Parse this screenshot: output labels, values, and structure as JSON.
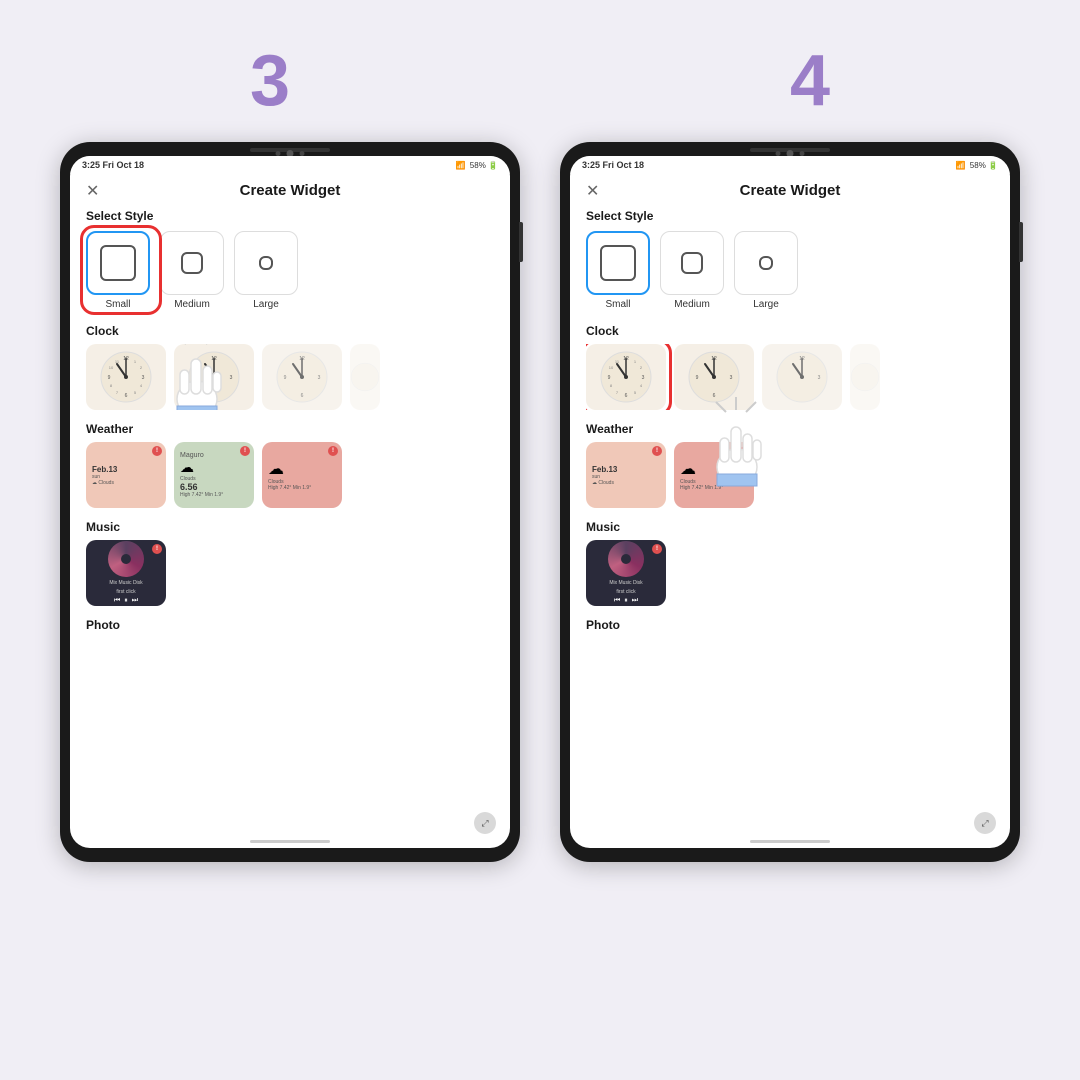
{
  "background_color": "#f0eef5",
  "steps": [
    {
      "number": "3",
      "color": "#9b7ec8"
    },
    {
      "number": "4",
      "color": "#9b7ec8"
    }
  ],
  "tablets": [
    {
      "id": "tablet-3",
      "status_bar": {
        "time": "3:25",
        "date": "Fri Oct 18",
        "signal": "58%",
        "battery": "▪"
      },
      "header": {
        "close": "✕",
        "title": "Create Widget"
      },
      "select_style_label": "Select Style",
      "style_options": [
        {
          "label": "Small",
          "size": "small",
          "selected": true
        },
        {
          "label": "Medium",
          "size": "medium",
          "selected": false
        },
        {
          "label": "Large",
          "size": "large",
          "selected": false
        }
      ],
      "sections": [
        {
          "label": "Clock",
          "widgets": [
            "clock1",
            "clock2",
            "clock3",
            "clock4"
          ]
        },
        {
          "label": "Weather",
          "widgets": [
            "weather1",
            "weather2",
            "weather3"
          ]
        },
        {
          "label": "Music",
          "widgets": [
            "music1"
          ]
        },
        {
          "label": "Photo"
        }
      ],
      "highlight": "style-small",
      "cursor_position": "clock_section"
    },
    {
      "id": "tablet-4",
      "status_bar": {
        "time": "3:25",
        "date": "Fri Oct 18",
        "signal": "58%",
        "battery": "▪"
      },
      "header": {
        "close": "✕",
        "title": "Create Widget"
      },
      "select_style_label": "Select Style",
      "style_options": [
        {
          "label": "Small",
          "size": "small",
          "selected": true
        },
        {
          "label": "Medium",
          "size": "medium",
          "selected": false
        },
        {
          "label": "Large",
          "size": "large",
          "selected": false
        }
      ],
      "sections": [
        {
          "label": "Clock",
          "widgets": [
            "clock1",
            "clock2",
            "clock3",
            "clock4"
          ]
        },
        {
          "label": "Weather",
          "widgets": [
            "weather1",
            "weather2",
            "weather3"
          ]
        },
        {
          "label": "Music",
          "widgets": [
            "music1"
          ]
        },
        {
          "label": "Photo"
        }
      ],
      "highlight": "clock-widget-1",
      "cursor_position": "weather_section"
    }
  ],
  "weather_data": {
    "widget1": {
      "date": "Feb.13",
      "condition": "sun",
      "sub": "☁ Clouds",
      "badge": "!"
    },
    "widget2": {
      "name": "Maguro",
      "condition": "Clouds",
      "temp": "6.56",
      "sub": "High 7.42° Min 1.9°",
      "badge": "!"
    },
    "widget3": {
      "condition": "Clouds",
      "sub": "High 7.42° Min 1.9°",
      "badge": "!"
    }
  },
  "music_data": {
    "title": "Mix Music Disk",
    "artist": "first click",
    "badge": "!"
  }
}
